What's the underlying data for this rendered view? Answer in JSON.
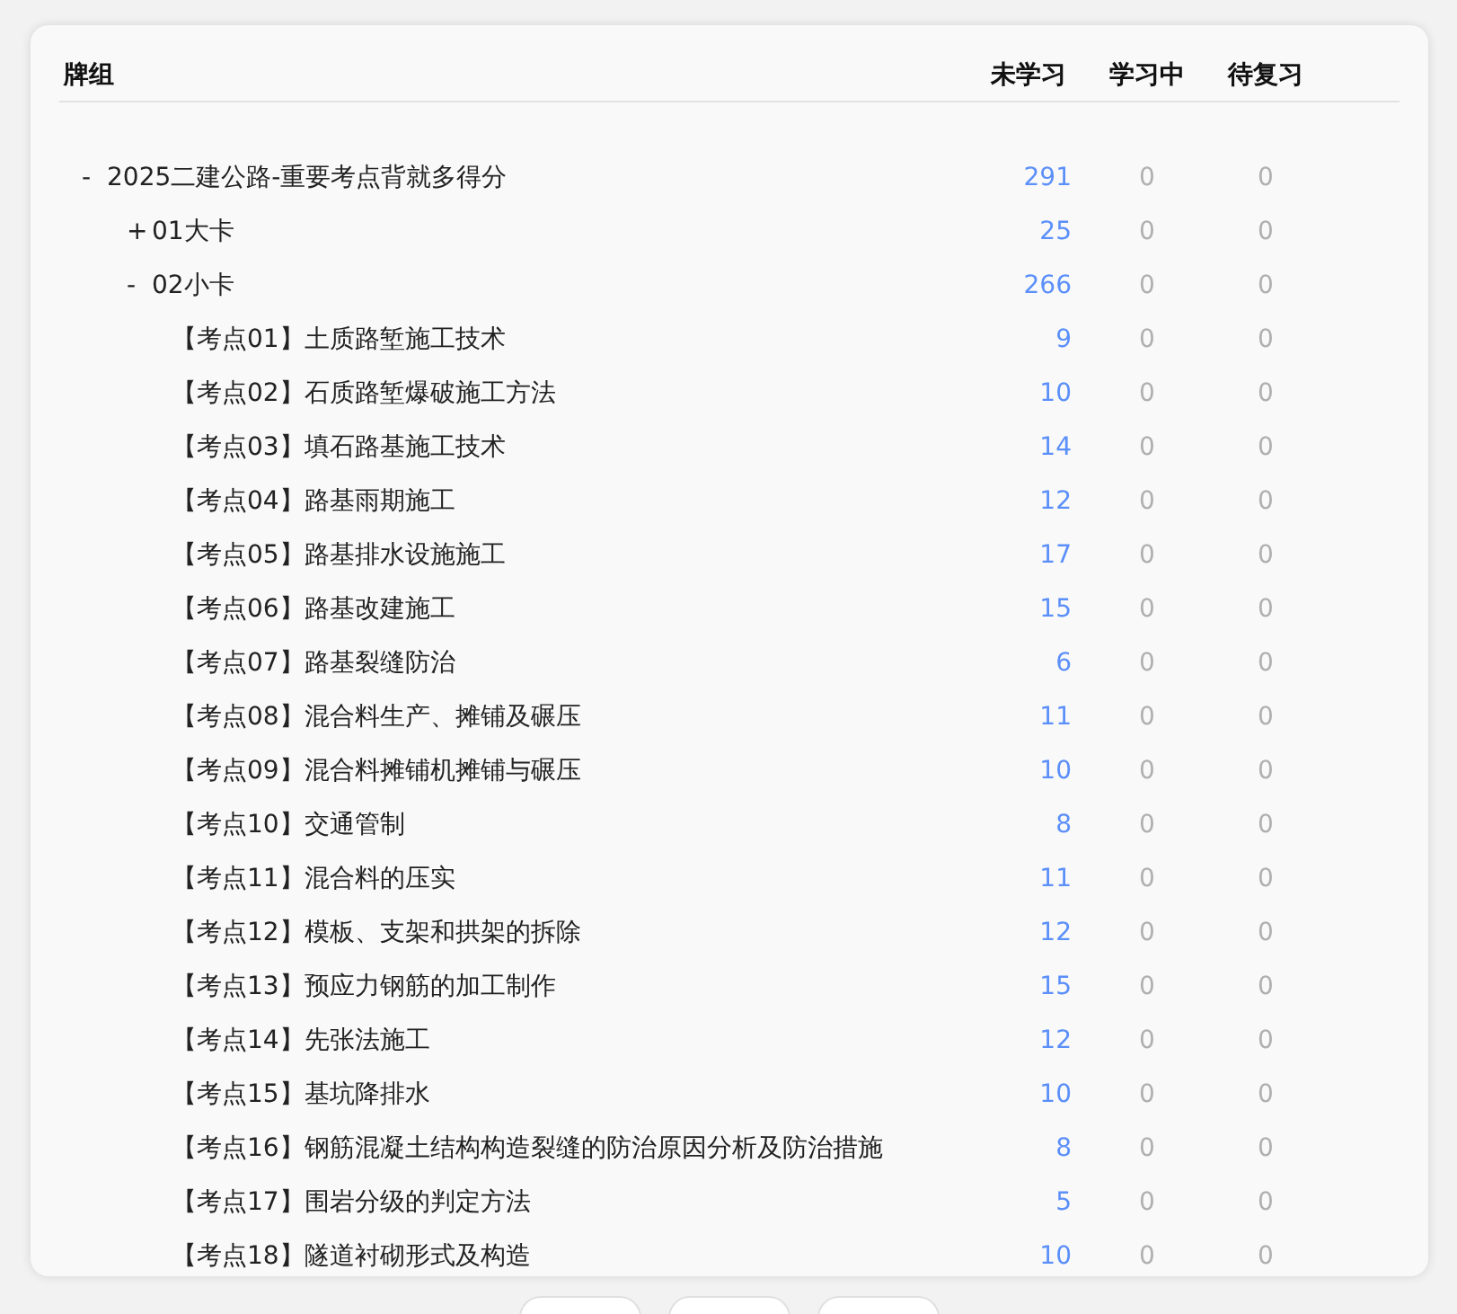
{
  "table": {
    "columns": [
      "牌组",
      "未学习",
      "学习中",
      "待复习"
    ],
    "rows": [
      {
        "toggle": "-",
        "name": "2025二建公路-重要考点背就多得分",
        "new": "291",
        "learning": "0",
        "review": "0",
        "children": [
          {
            "toggle": "+",
            "name": "01大卡",
            "new": "25",
            "learning": "0",
            "review": "0"
          },
          {
            "toggle": "-",
            "name": "02小卡",
            "new": "266",
            "learning": "0",
            "review": "0",
            "children": [
              {
                "name": "【考点01】土质路堑施工技术",
                "new": "9",
                "learning": "0",
                "review": "0"
              },
              {
                "name": "【考点02】石质路堑爆破施工方法",
                "new": "10",
                "learning": "0",
                "review": "0"
              },
              {
                "name": "【考点03】填石路基施工技术",
                "new": "14",
                "learning": "0",
                "review": "0"
              },
              {
                "name": "【考点04】路基雨期施工",
                "new": "12",
                "learning": "0",
                "review": "0"
              },
              {
                "name": "【考点05】路基排水设施施工",
                "new": "17",
                "learning": "0",
                "review": "0"
              },
              {
                "name": "【考点06】路基改建施工",
                "new": "15",
                "learning": "0",
                "review": "0"
              },
              {
                "name": "【考点07】路基裂缝防治",
                "new": "6",
                "learning": "0",
                "review": "0"
              },
              {
                "name": "【考点08】混合料生产、摊铺及碾压",
                "new": "11",
                "learning": "0",
                "review": "0"
              },
              {
                "name": "【考点09】混合料摊铺机摊铺与碾压",
                "new": "10",
                "learning": "0",
                "review": "0"
              },
              {
                "name": "【考点10】交通管制",
                "new": "8",
                "learning": "0",
                "review": "0"
              },
              {
                "name": "【考点11】混合料的压实",
                "new": "11",
                "learning": "0",
                "review": "0"
              },
              {
                "name": "【考点12】模板、支架和拱架的拆除",
                "new": "12",
                "learning": "0",
                "review": "0"
              },
              {
                "name": "【考点13】预应力钢筋的加工制作",
                "new": "15",
                "learning": "0",
                "review": "0"
              },
              {
                "name": "【考点14】先张法施工",
                "new": "12",
                "learning": "0",
                "review": "0"
              },
              {
                "name": "【考点15】基坑降排水",
                "new": "10",
                "learning": "0",
                "review": "0"
              },
              {
                "name": "【考点16】钢筋混凝土结构构造裂缝的防治原因分析及防治措施",
                "new": "8",
                "learning": "0",
                "review": "0"
              },
              {
                "name": "【考点17】围岩分级的判定方法",
                "new": "5",
                "learning": "0",
                "review": "0"
              },
              {
                "name": "【考点18】隧道衬砌形式及构造",
                "new": "10",
                "learning": "0",
                "review": "0"
              }
            ]
          }
        ]
      }
    ]
  },
  "bottom_buttons": [
    {
      "kind": "button"
    },
    {
      "kind": "button"
    },
    {
      "kind": "button"
    }
  ]
}
